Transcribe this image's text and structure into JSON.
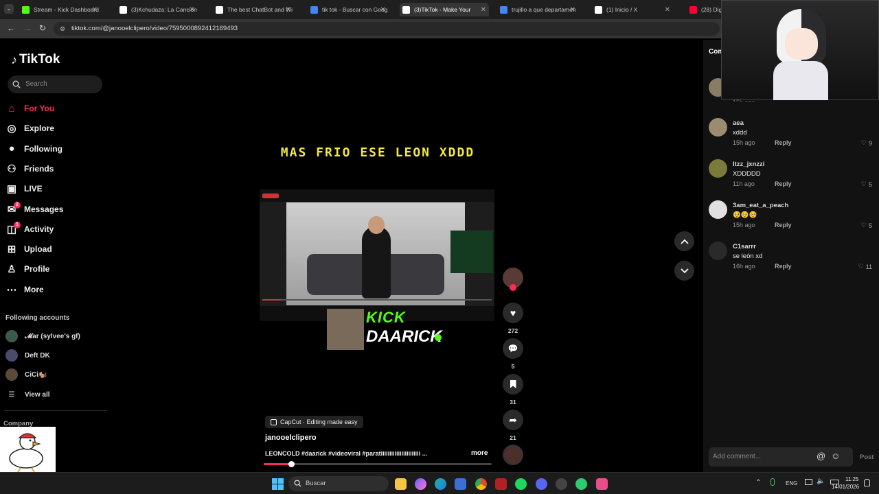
{
  "browser": {
    "tabs": [
      {
        "label": "Stream - Kick Dashboard",
        "icon": "kick-icon",
        "color": "#53fc18"
      },
      {
        "label": "(3)Kchudaza: La Canción",
        "icon": "tiktok-icon",
        "color": "#ffffff"
      },
      {
        "label": "The best ChatBot and Wi",
        "icon": "chatbot-icon",
        "color": "#ffffff"
      },
      {
        "label": "tik tok - Buscar con Goog",
        "icon": "google-icon",
        "color": "#4285f4"
      },
      {
        "label": "(3)TikTok - Make Your",
        "icon": "tiktok-icon",
        "color": "#ffffff"
      },
      {
        "label": "trujillo a que departamen",
        "icon": "google-icon",
        "color": "#4285f4"
      },
      {
        "label": "(1) Inicio / X",
        "icon": "x-icon",
        "color": "#ffffff"
      },
      {
        "label": "(28) Digi",
        "icon": "youtube-icon",
        "color": "#ff0033"
      }
    ],
    "url": "tiktok.com/@janooelclipero/video/7595000892412169493"
  },
  "sidebar": {
    "logo": "TikTok",
    "search_placeholder": "Search",
    "nav": [
      {
        "label": "For You",
        "icon": "home-icon",
        "active": true
      },
      {
        "label": "Explore",
        "icon": "compass-icon"
      },
      {
        "label": "Following",
        "icon": "following-avatar-icon"
      },
      {
        "label": "Friends",
        "icon": "friends-icon"
      },
      {
        "label": "LIVE",
        "icon": "live-icon"
      },
      {
        "label": "Messages",
        "icon": "messages-icon",
        "badge": "2"
      },
      {
        "label": "Activity",
        "icon": "activity-icon",
        "badge": "1"
      },
      {
        "label": "Upload",
        "icon": "upload-icon"
      },
      {
        "label": "Profile",
        "icon": "profile-icon"
      },
      {
        "label": "More",
        "icon": "more-icon"
      }
    ],
    "following_title": "Following accounts",
    "accounts": [
      {
        "name": "𝓜ar (sylvee's gf)"
      },
      {
        "name": "Deft DK"
      },
      {
        "name": "CiCi🐿️"
      }
    ],
    "view_all": "View all",
    "company": "Company"
  },
  "video": {
    "caption_overlay": "MAS FRIO ESE LEON XDDD",
    "kick_text_1": "KICK",
    "kick_text_2": "DAARICK",
    "capcut_label": "CapCut · Editing made easy",
    "author": "janooelclipero",
    "description": "LEONCOLD #daarick #videoviral #paratiiiiiiiiiiiiiiiiiiiiiii ...",
    "more_label": "more",
    "progress": 0.12
  },
  "actions": {
    "likes": "272",
    "comments": "5",
    "saves": "31",
    "shares": "21"
  },
  "comments_panel": {
    "title_partial": "Com",
    "items": [
      {
        "user": "aea",
        "text": "xddd",
        "time": "15h ago",
        "reply": "Reply",
        "likes": "9"
      },
      {
        "user": "Itzz_jxnzzi",
        "text": "XDDDDD",
        "time": "11h ago",
        "reply": "Reply",
        "likes": "5"
      },
      {
        "user": "3am_eat_a_peach",
        "text": "🥺🥺🥺",
        "time": "15h ago",
        "reply": "Reply",
        "likes": "5"
      },
      {
        "user": "C1sarrr",
        "text": "se león xd",
        "time": "16h ago",
        "reply": "Reply",
        "likes": "11"
      }
    ],
    "partial_time": "15h ago",
    "partial_reply": "Reply",
    "add_comment_placeholder": "Add comment...",
    "post_label": "Post"
  },
  "taskbar": {
    "search_label": "Buscar",
    "lang": "ENG",
    "time": "11:25",
    "date": "14/01/2026"
  }
}
